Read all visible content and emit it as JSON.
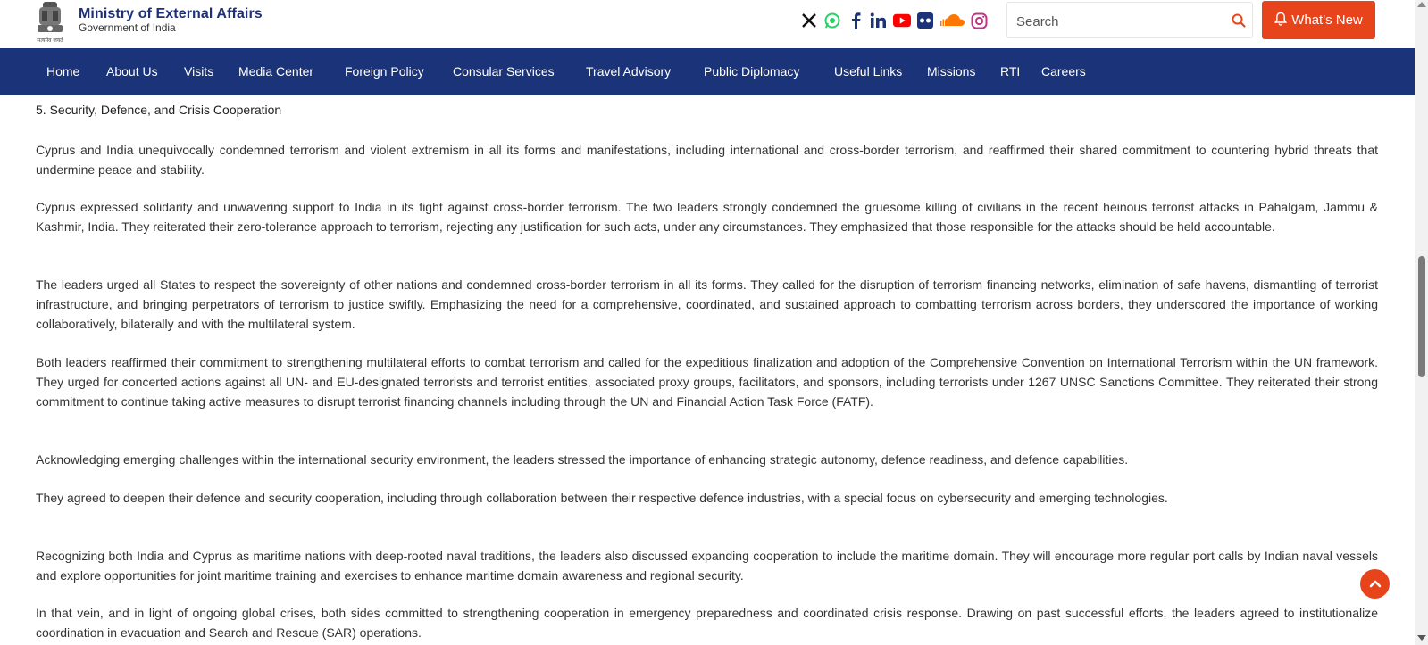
{
  "header": {
    "title": "Ministry of External Affairs",
    "subtitle": "Government of India",
    "emblem_caption": "सत्यमेव जयते",
    "socials": [
      {
        "name": "x-icon",
        "glyph": "X",
        "color": "#000000"
      },
      {
        "name": "whatsapp-icon",
        "glyph": "✆",
        "color": "#25d366"
      },
      {
        "name": "facebook-icon",
        "glyph": "f",
        "color": "#1b3378"
      },
      {
        "name": "linkedin-icon",
        "glyph": "in",
        "color": "#1b3378"
      },
      {
        "name": "youtube-icon",
        "glyph": "▶",
        "color": "#ff0000"
      },
      {
        "name": "flickr-icon",
        "glyph": "••",
        "color": "#1b3378"
      },
      {
        "name": "soundcloud-icon",
        "glyph": "☁",
        "color": "#ff7700"
      },
      {
        "name": "instagram-icon",
        "glyph": "◎",
        "color": "#c13584"
      }
    ],
    "search_placeholder": "Search",
    "whats_new": "What's New"
  },
  "nav": [
    "Home",
    "About Us",
    "Visits",
    "Media Center",
    "Foreign Policy",
    "Consular Services",
    "Travel Advisory",
    "Public Diplomacy",
    "Useful Links",
    "Missions",
    "RTI",
    "Careers"
  ],
  "content": {
    "heading": "5. Security, Defence, and Crisis Cooperation",
    "paragraphs": [
      "Cyprus and India unequivocally condemned terrorism and violent extremism in all its forms and manifestations, including international and cross-border terrorism, and reaffirmed their shared commitment to countering hybrid threats that undermine peace and stability.",
      "Cyprus expressed solidarity and unwavering support to India in its fight against cross-border terrorism. The two leaders strongly condemned the gruesome killing of civilians in the recent heinous terrorist attacks in Pahalgam, Jammu & Kashmir, India. They reiterated their zero-tolerance approach to terrorism, rejecting any justification for such acts, under any circumstances. They emphasized that those responsible for the attacks should be held accountable.",
      "The leaders urged all States to respect the sovereignty of other nations and condemned cross-border terrorism in all its forms. They called for the disruption of terrorism financing networks, elimination of safe havens, dismantling of terrorist infrastructure, and bringing perpetrators of terrorism to justice swiftly. Emphasizing the need for a comprehensive, coordinated, and sustained approach to combatting terrorism across borders, they underscored the importance of working collaboratively, bilaterally and with the multilateral system.",
      "Both leaders reaffirmed their commitment to strengthening multilateral efforts to combat terrorism and called for the expeditious finalization and adoption of the Comprehensive Convention on International Terrorism within the UN framework. They urged for concerted actions against all UN- and EU-designated terrorists and terrorist entities, associated proxy groups, facilitators, and sponsors, including terrorists under 1267 UNSC Sanctions Committee. They reiterated their strong commitment to continue taking active measures to disrupt terrorist financing channels including through the UN and Financial Action Task Force (FATF).",
      "Acknowledging emerging challenges within the international security environment, the leaders stressed the importance of enhancing strategic autonomy, defence readiness, and defence capabilities.",
      "They agreed to deepen their defence and security cooperation, including through collaboration between their respective defence industries, with a special focus on cybersecurity and emerging technologies.",
      "Recognizing both India and Cyprus as maritime nations with deep-rooted naval traditions, the leaders also discussed expanding cooperation to include the maritime domain. They will encourage more regular port calls by Indian naval vessels and explore opportunities for joint maritime training and exercises to enhance maritime domain awareness and regional security.",
      "In that vein, and in light of ongoing global crises, both sides committed to strengthening cooperation in emergency preparedness and coordinated crisis response. Drawing on past successful efforts, the leaders agreed to institutionalize coordination in evacuation and Search and Rescue (SAR) operations."
    ]
  },
  "colors": {
    "nav_bg": "#1b3378",
    "accent": "#e8441c",
    "title": "#1d3078"
  }
}
